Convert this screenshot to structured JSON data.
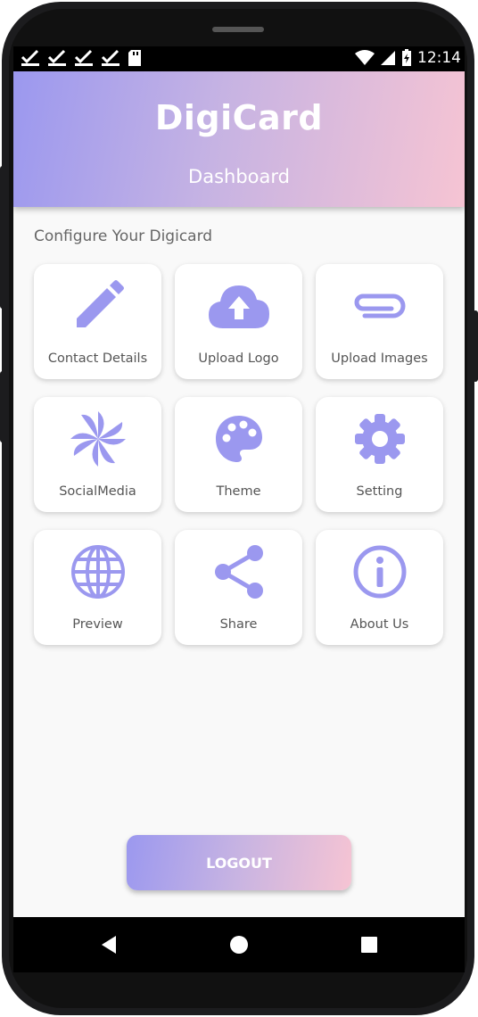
{
  "status_bar": {
    "time": "12:14",
    "left_icons": [
      "check-notification-icon",
      "check-notification-icon",
      "check-notification-icon",
      "check-notification-icon",
      "sd-card-icon"
    ],
    "right_icons": [
      "wifi-icon",
      "cell-signal-icon",
      "battery-charging-icon"
    ]
  },
  "header": {
    "title": "DigiCard",
    "subtitle": "Dashboard",
    "gradient_start": "#9b98ef",
    "gradient_end": "#f6c4d3"
  },
  "section": {
    "label": "Configure Your Digicard"
  },
  "tiles": [
    {
      "label": "Contact Details",
      "icon": "pencil-icon"
    },
    {
      "label": "Upload Logo",
      "icon": "cloud-upload-icon"
    },
    {
      "label": "Upload Images",
      "icon": "paperclip-icon"
    },
    {
      "label": "SocialMedia",
      "icon": "pinwheel-icon"
    },
    {
      "label": "Theme",
      "icon": "palette-icon"
    },
    {
      "label": "Setting",
      "icon": "gear-icon"
    },
    {
      "label": "Preview",
      "icon": "globe-icon"
    },
    {
      "label": "Share",
      "icon": "share-icon"
    },
    {
      "label": "About Us",
      "icon": "info-icon"
    }
  ],
  "icon_color": "#9b98ef",
  "logout": {
    "label": "LOGOUT"
  },
  "nav_bar": {
    "buttons": [
      "back-icon",
      "home-icon",
      "recents-icon"
    ]
  }
}
